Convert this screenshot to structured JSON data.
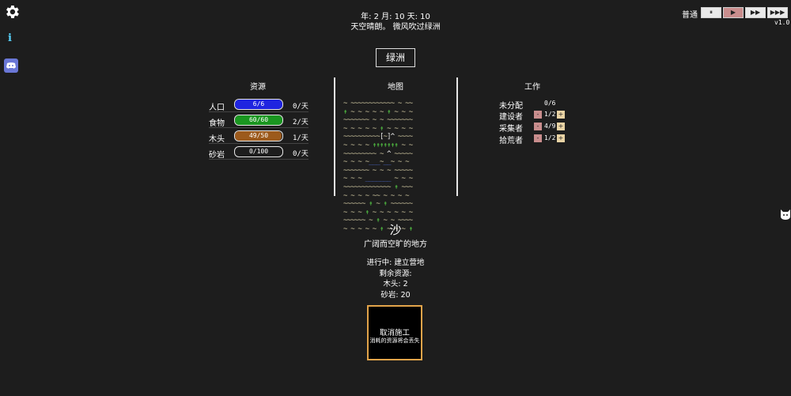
{
  "header": {
    "date": "年: 2 月: 10 天: 10",
    "weather": "天空晴朗。 微风吹过绿洲"
  },
  "speed": {
    "label": "普通",
    "buttons": [
      "⏸",
      "▶",
      "▶▶",
      "▶▶▶"
    ],
    "active_index": 1,
    "version": "v1.0"
  },
  "location": {
    "name": "绿洲"
  },
  "resources": {
    "title": "资源",
    "items": [
      {
        "name": "人口",
        "value": "6/6",
        "fill": 1.0,
        "color": "#1f24e0",
        "rate": "0/天"
      },
      {
        "name": "食物",
        "value": "60/60",
        "fill": 1.0,
        "color": "#1a9620",
        "rate": "2/天"
      },
      {
        "name": "木头",
        "value": "49/50",
        "fill": 0.98,
        "color": "#9c5a1c",
        "rate": "1/天"
      },
      {
        "name": "砂岩",
        "value": "0/100",
        "fill": 0.0,
        "color": "#555555",
        "rate": "0/天"
      }
    ]
  },
  "map": {
    "title": "地图",
    "rows": [
      "~ ~~~~~~~~~~~~ ~ ~~",
      "g ~ ~ ~ ~ ~ g ~ ~ ~",
      "~~~~~~~ ~ ~ ~~~~~~~",
      "~ ~ ~ ~ ~ g ~ ~ ~ ~",
      "~~~~~~~~~~[~]^ ~~~~",
      "~ ~ ~ ~ ggggggg ~ ~",
      "~~~~~~~~~ ~ ^ ~~~~~",
      "~ ~ ~ ~___~__~ ~ ~ ",
      "~~~~~~~ ~ ~ ~ ~~~~~",
      "~ ~ ~ _______ ~ ~ ~",
      "~~~~~~~~~~~~~ g ~~~",
      "~ ~ ~ ~ ~~ ~ ~ ~ ~ ",
      "~~~~~~ g ~ g ~~~~~~",
      "~ ~ ~ g ~ ~ ~ ~ ~ ~",
      "~~~~~~ ~ g ~ ~ ~~~~",
      "~ ~ ~ ~ ~ g ~ ~ ~ g"
    ]
  },
  "terrain": {
    "name": "沙",
    "description": "广阔而空旷的地方"
  },
  "project": {
    "status": "进行中: 建立营地",
    "remaining_label": "剩余资源:",
    "remaining": [
      "木头: 2",
      "砂岩: 20"
    ]
  },
  "cancel": {
    "title": "取消施工",
    "subtitle": "消耗的资源将会丢失"
  },
  "jobs": {
    "title": "工作",
    "unassigned_label": "未分配",
    "unassigned_value": "0/6",
    "items": [
      {
        "name": "建设者",
        "value": "1/2"
      },
      {
        "name": "采集者",
        "value": "4/9"
      },
      {
        "name": "拾荒者",
        "value": "1/2"
      }
    ],
    "minus": "-",
    "plus": "+"
  }
}
